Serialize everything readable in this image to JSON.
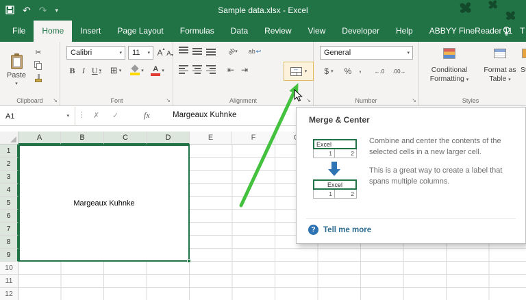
{
  "window": {
    "title": "Sample data.xlsx  -  Excel"
  },
  "tabs": {
    "file": "File",
    "home": "Home",
    "insert": "Insert",
    "page_layout": "Page Layout",
    "formulas": "Formulas",
    "data": "Data",
    "review": "Review",
    "view": "View",
    "developer": "Developer",
    "help": "Help",
    "abbyy": "ABBYY FineReader 11",
    "tellme": "T"
  },
  "ribbon": {
    "clipboard": {
      "label": "Clipboard",
      "paste": "Paste"
    },
    "font": {
      "label": "Font",
      "name": "Calibri",
      "size": "11",
      "bold": "B",
      "italic": "I",
      "underline": "U"
    },
    "alignment": {
      "label": "Alignment",
      "orientation": "ab",
      "wrap": "ab"
    },
    "number": {
      "label": "Number",
      "format": "General",
      "currency": "$",
      "percent": "%",
      "comma": ",",
      "inc_decimal": "←.0",
      "dec_decimal": ".00→"
    },
    "styles": {
      "label": "Styles",
      "conditional_line1": "Conditional",
      "conditional_line2": "Formatting",
      "table_line1": "Format as",
      "table_line2": "Table",
      "cell_styles": "St"
    }
  },
  "formula_bar": {
    "name_box": "A1",
    "cancel": "✗",
    "enter": "✓",
    "insert_function": "fx",
    "content": "Margeaux Kuhnke"
  },
  "sheet": {
    "cols": [
      "A",
      "B",
      "C",
      "D",
      "E",
      "F",
      "G"
    ],
    "rows": [
      "1",
      "2",
      "3",
      "4",
      "5",
      "6",
      "7",
      "8",
      "9",
      "10",
      "11",
      "12"
    ],
    "cell_text": "Margeaux Kuhnke",
    "selected_range": "A1:D9"
  },
  "tooltip": {
    "title": "Merge & Center",
    "para1": "Combine and center the contents of the selected cells in a new larger cell.",
    "para2": "This is a great way to create a label that spans multiple columns.",
    "link": "Tell me more",
    "question": "?",
    "mini1_header": "Excel",
    "mini1_c1": "1",
    "mini1_c2": "2",
    "mini2_header": "Excel",
    "mini2_c1": "1",
    "mini2_c2": "2"
  },
  "icons": {
    "caret": "▾",
    "caret_up": "▴",
    "undo": "↶",
    "redo": "↷",
    "dots": "⋮",
    "scissors": "✂",
    "borders": "⊞",
    "grow": "A",
    "shrink": "A",
    "launcher": "↘",
    "indent_dec": "⇤",
    "indent_inc": "⇥",
    "wrap_return": "↩",
    "merge_arrow": "↔"
  },
  "colors": {
    "excel_green": "#217346",
    "arrow_green": "#44c13f",
    "link_blue": "#2e6d91",
    "illus_arrow_blue": "#2e74b5"
  }
}
